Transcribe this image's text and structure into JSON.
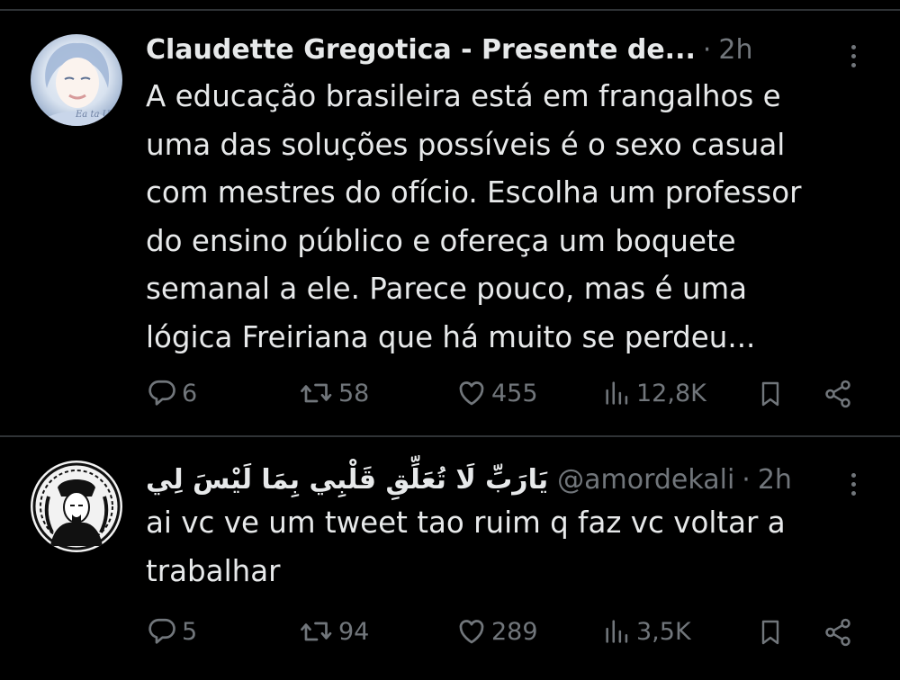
{
  "tweets": [
    {
      "author": "Claudette Gregotica - Presente de...",
      "handle": "",
      "time": "2h",
      "dot": "·",
      "text": "A educação brasileira está em frangalhos e uma das soluções possíveis é o sexo casual com mestres do ofício. Escolha um professor do ensino público e ofereça um boquete semanal a ele. Parece pouco, mas é uma lógica Freiriana que há muito se perdeu...",
      "lines": [
        "A educação brasileira está em frangalhos e",
        "uma das soluções possíveis é o sexo casual",
        "com mestres do ofício. Escolha um professor",
        "do ensino público e ofereça um boquete",
        "semanal a ele. Parece pouco, mas é uma",
        "lógica Freiriana que há muito se perdeu..."
      ],
      "replies": "6",
      "reposts": "58",
      "likes": "455",
      "views": "12,8K",
      "avatar_icon": "profile-photo-woman",
      "avatar_watermark": "Ea ta Ua"
    },
    {
      "author": "يَارَبِّ لَا تُعَلِّقِ قَلْبِي بِمَا لَيْسَ لِي",
      "handle": "@amordekali",
      "time": "2h",
      "dot": "·",
      "lines": [
        "ai vc ve um tweet tao ruim q faz vc voltar a",
        "trabalhar"
      ],
      "replies": "5",
      "reposts": "94",
      "likes": "289",
      "views": "3,5K",
      "avatar_icon": "profile-illustration-kali"
    }
  ],
  "colors": {
    "background": "#000000",
    "text": "#e7e9ea",
    "muted": "#71767b",
    "divider": "#2f3336"
  },
  "icons": [
    "reply-icon",
    "repost-icon",
    "like-icon",
    "views-icon",
    "bookmark-icon",
    "share-icon",
    "more-icon"
  ]
}
